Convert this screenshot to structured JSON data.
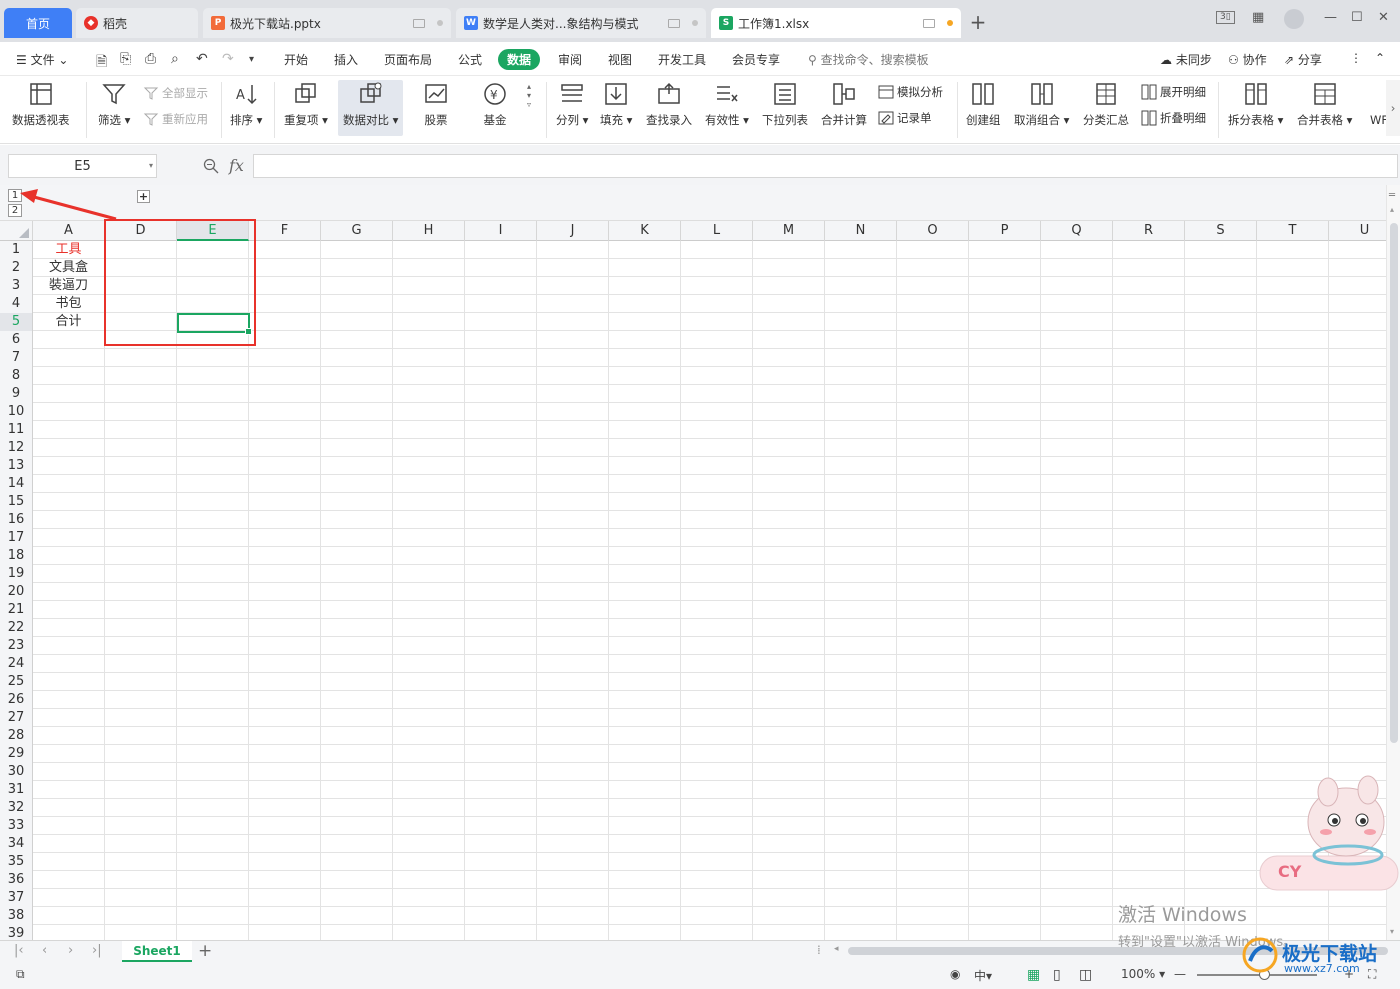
{
  "tabs": [
    {
      "label": "首页",
      "kind": "home"
    },
    {
      "label": "稻壳",
      "kind": "docer",
      "color": "#e8322b"
    },
    {
      "label": "极光下载站.pptx",
      "kind": "ppt",
      "color": "#f26b3a"
    },
    {
      "label": "数学是人类对...象结构与模式",
      "kind": "word",
      "color": "#3f7ff6"
    },
    {
      "label": "工作簿1.xlsx",
      "kind": "sheet",
      "color": "#1ba661",
      "active": true
    }
  ],
  "window_controls": {
    "panel_badge": "3",
    "grid_icon": "apps-icon",
    "avatar_icon": "avatar-icon"
  },
  "menu": {
    "file": "文件",
    "items": [
      "开始",
      "插入",
      "页面布局",
      "公式",
      "数据",
      "审阅",
      "视图",
      "开发工具",
      "会员专享"
    ],
    "active": "数据",
    "search_placeholder": "查找命令、搜索模板",
    "sync": "未同步",
    "collab": "协作",
    "share": "分享"
  },
  "ribbon": {
    "pivot": "数据透视表",
    "filter": "筛选",
    "show_all": "全部显示",
    "reapply": "重新应用",
    "sort": "排序",
    "duplicates": "重复项",
    "compare": "数据对比",
    "stock": "股票",
    "fund": "基金",
    "split_col": "分列",
    "fill": "填充",
    "lookup": "查找录入",
    "validity": "有效性",
    "dropdown": "下拉列表",
    "consolidate": "合并计算",
    "simulate": "模拟分析",
    "record": "记录单",
    "group": "创建组",
    "ungroup": "取消组合",
    "subtotal": "分类汇总",
    "expand": "展开明细",
    "collapse": "折叠明细",
    "split_table": "拆分表格",
    "merge_table": "合并表格",
    "more": "WF"
  },
  "formula_bar": {
    "cell_ref": "E5",
    "fx": "fx",
    "value": ""
  },
  "outline": {
    "levels": [
      "1",
      "2"
    ],
    "expand": "+"
  },
  "columns": [
    "A",
    "D",
    "E",
    "F",
    "G",
    "H",
    "I",
    "J",
    "K",
    "L",
    "M",
    "N",
    "O",
    "P",
    "Q",
    "R",
    "S",
    "T",
    "U"
  ],
  "selected_column": "E",
  "selected_row": "5",
  "cells_A": [
    "工具",
    "文具盒",
    "裝逼刀",
    "书包",
    "合计"
  ],
  "sheet": {
    "name": "Sheet1",
    "add": "+"
  },
  "status": {
    "zoom": "100%"
  },
  "watermark": {
    "line1": "激活 Windows",
    "line2": "转到\"设置\"以激活 Windows。",
    "site": "极光下载站",
    "url": "www.xz7.com"
  },
  "mascot_text": "CY",
  "colors": {
    "accent": "#1ba661",
    "highlight_box": "#e8322b",
    "home_tab": "#3f7ff6"
  }
}
